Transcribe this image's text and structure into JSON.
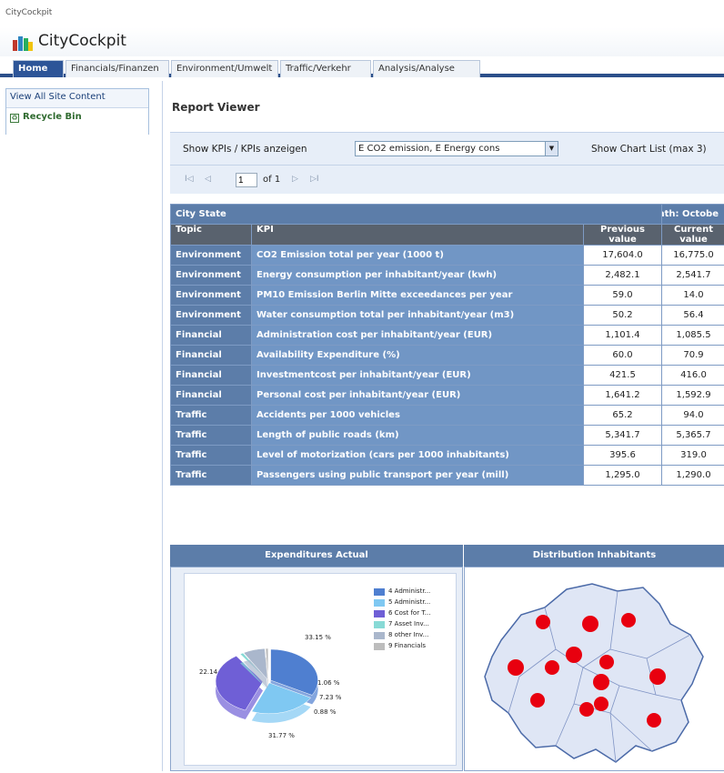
{
  "breadcrumb": "CityCockpit",
  "site_title": "CityCockpit",
  "tabs": [
    {
      "label": "Home",
      "active": true
    },
    {
      "label": "Financials/Finanzen",
      "active": false
    },
    {
      "label": "Environment/Umwelt",
      "active": false
    },
    {
      "label": "Traffic/Verkehr",
      "active": false
    },
    {
      "label": "Analysis/Analyse",
      "active": false
    }
  ],
  "quick_launch": {
    "view_all": "View All Site Content",
    "recycle_bin": "Recycle Bin"
  },
  "report": {
    "title": "Report Viewer",
    "kpi_label": "Show KPIs / KPIs anzeigen",
    "kpi_select_value": "E CO2 emission, E Energy cons",
    "chart_list_label": "Show Chart List (max 3)",
    "pager": {
      "first": "I◁",
      "prev": "◁",
      "page": "1",
      "of": "of 1",
      "next": "▷",
      "last": "▷I"
    }
  },
  "table": {
    "group_header": "City State",
    "reporting_month": "Reporting Month: Octobe",
    "col_topic": "Topic",
    "col_kpi": "KPI",
    "col_prev": "Previous value",
    "col_curr": "Current value",
    "rows": [
      {
        "topic": "Environment",
        "kpi": "CO2 Emission total per year (1000 t)",
        "prev": "17,604.0",
        "curr": "16,775.0"
      },
      {
        "topic": "Environment",
        "kpi": "Energy consumption per inhabitant/year (kwh)",
        "prev": "2,482.1",
        "curr": "2,541.7"
      },
      {
        "topic": "Environment",
        "kpi": "PM10 Emission Berlin Mitte exceedances per year",
        "prev": "59.0",
        "curr": "14.0"
      },
      {
        "topic": "Environment",
        "kpi": "Water consumption total per inhabitant/year (m3)",
        "prev": "50.2",
        "curr": "56.4"
      },
      {
        "topic": "Financial",
        "kpi": "Administration cost per inhabitant/year (EUR)",
        "prev": "1,101.4",
        "curr": "1,085.5"
      },
      {
        "topic": "Financial",
        "kpi": "Availability Expenditure (%)",
        "prev": "60.0",
        "curr": "70.9"
      },
      {
        "topic": "Financial",
        "kpi": "Investmentcost per inhabitant/year (EUR)",
        "prev": "421.5",
        "curr": "416.0"
      },
      {
        "topic": "Financial",
        "kpi": "Personal cost per inhabitant/year (EUR)",
        "prev": "1,641.2",
        "curr": "1,592.9"
      },
      {
        "topic": "Traffic",
        "kpi": "Accidents per 1000 vehicles",
        "prev": "65.2",
        "curr": "94.0"
      },
      {
        "topic": "Traffic",
        "kpi": "Length of public roads (km)",
        "prev": "5,341.7",
        "curr": "5,365.7"
      },
      {
        "topic": "Traffic",
        "kpi": "Level of motorization (cars per 1000 inhabitants)",
        "prev": "395.6",
        "curr": "319.0"
      },
      {
        "topic": "Traffic",
        "kpi": "Passengers using public transport per year (mill)",
        "prev": "1,295.0",
        "curr": "1,290.0"
      }
    ]
  },
  "charts": {
    "expenditures_title": "Expenditures Actual",
    "distribution_title": "Distribution Inhabitants"
  },
  "chart_data": {
    "type": "pie",
    "title": "Expenditures Actual",
    "categories": [
      "4 Administr...",
      "5 Administr...",
      "6 Cost for T...",
      "7 Asset Inv...",
      "8 other Inv...",
      "9 Financials"
    ],
    "values": [
      31.77,
      22.14,
      33.15,
      1.06,
      7.23,
      0.88
    ],
    "value_labels": [
      "31.77 %",
      "22.14 %",
      "33.15 %",
      "1.06 %",
      "7.23 %",
      "0.88 %"
    ],
    "colors": [
      "#4f7fd0",
      "#7fc8f2",
      "#6f5fd6",
      "#88dad6",
      "#aab7cc",
      "#bdbdbd"
    ],
    "legend": "right"
  },
  "icons": {
    "logo": "citycockpit-logo-icon",
    "recycle": "recycle-bin-icon",
    "dropdown": "chevron-down-icon"
  }
}
